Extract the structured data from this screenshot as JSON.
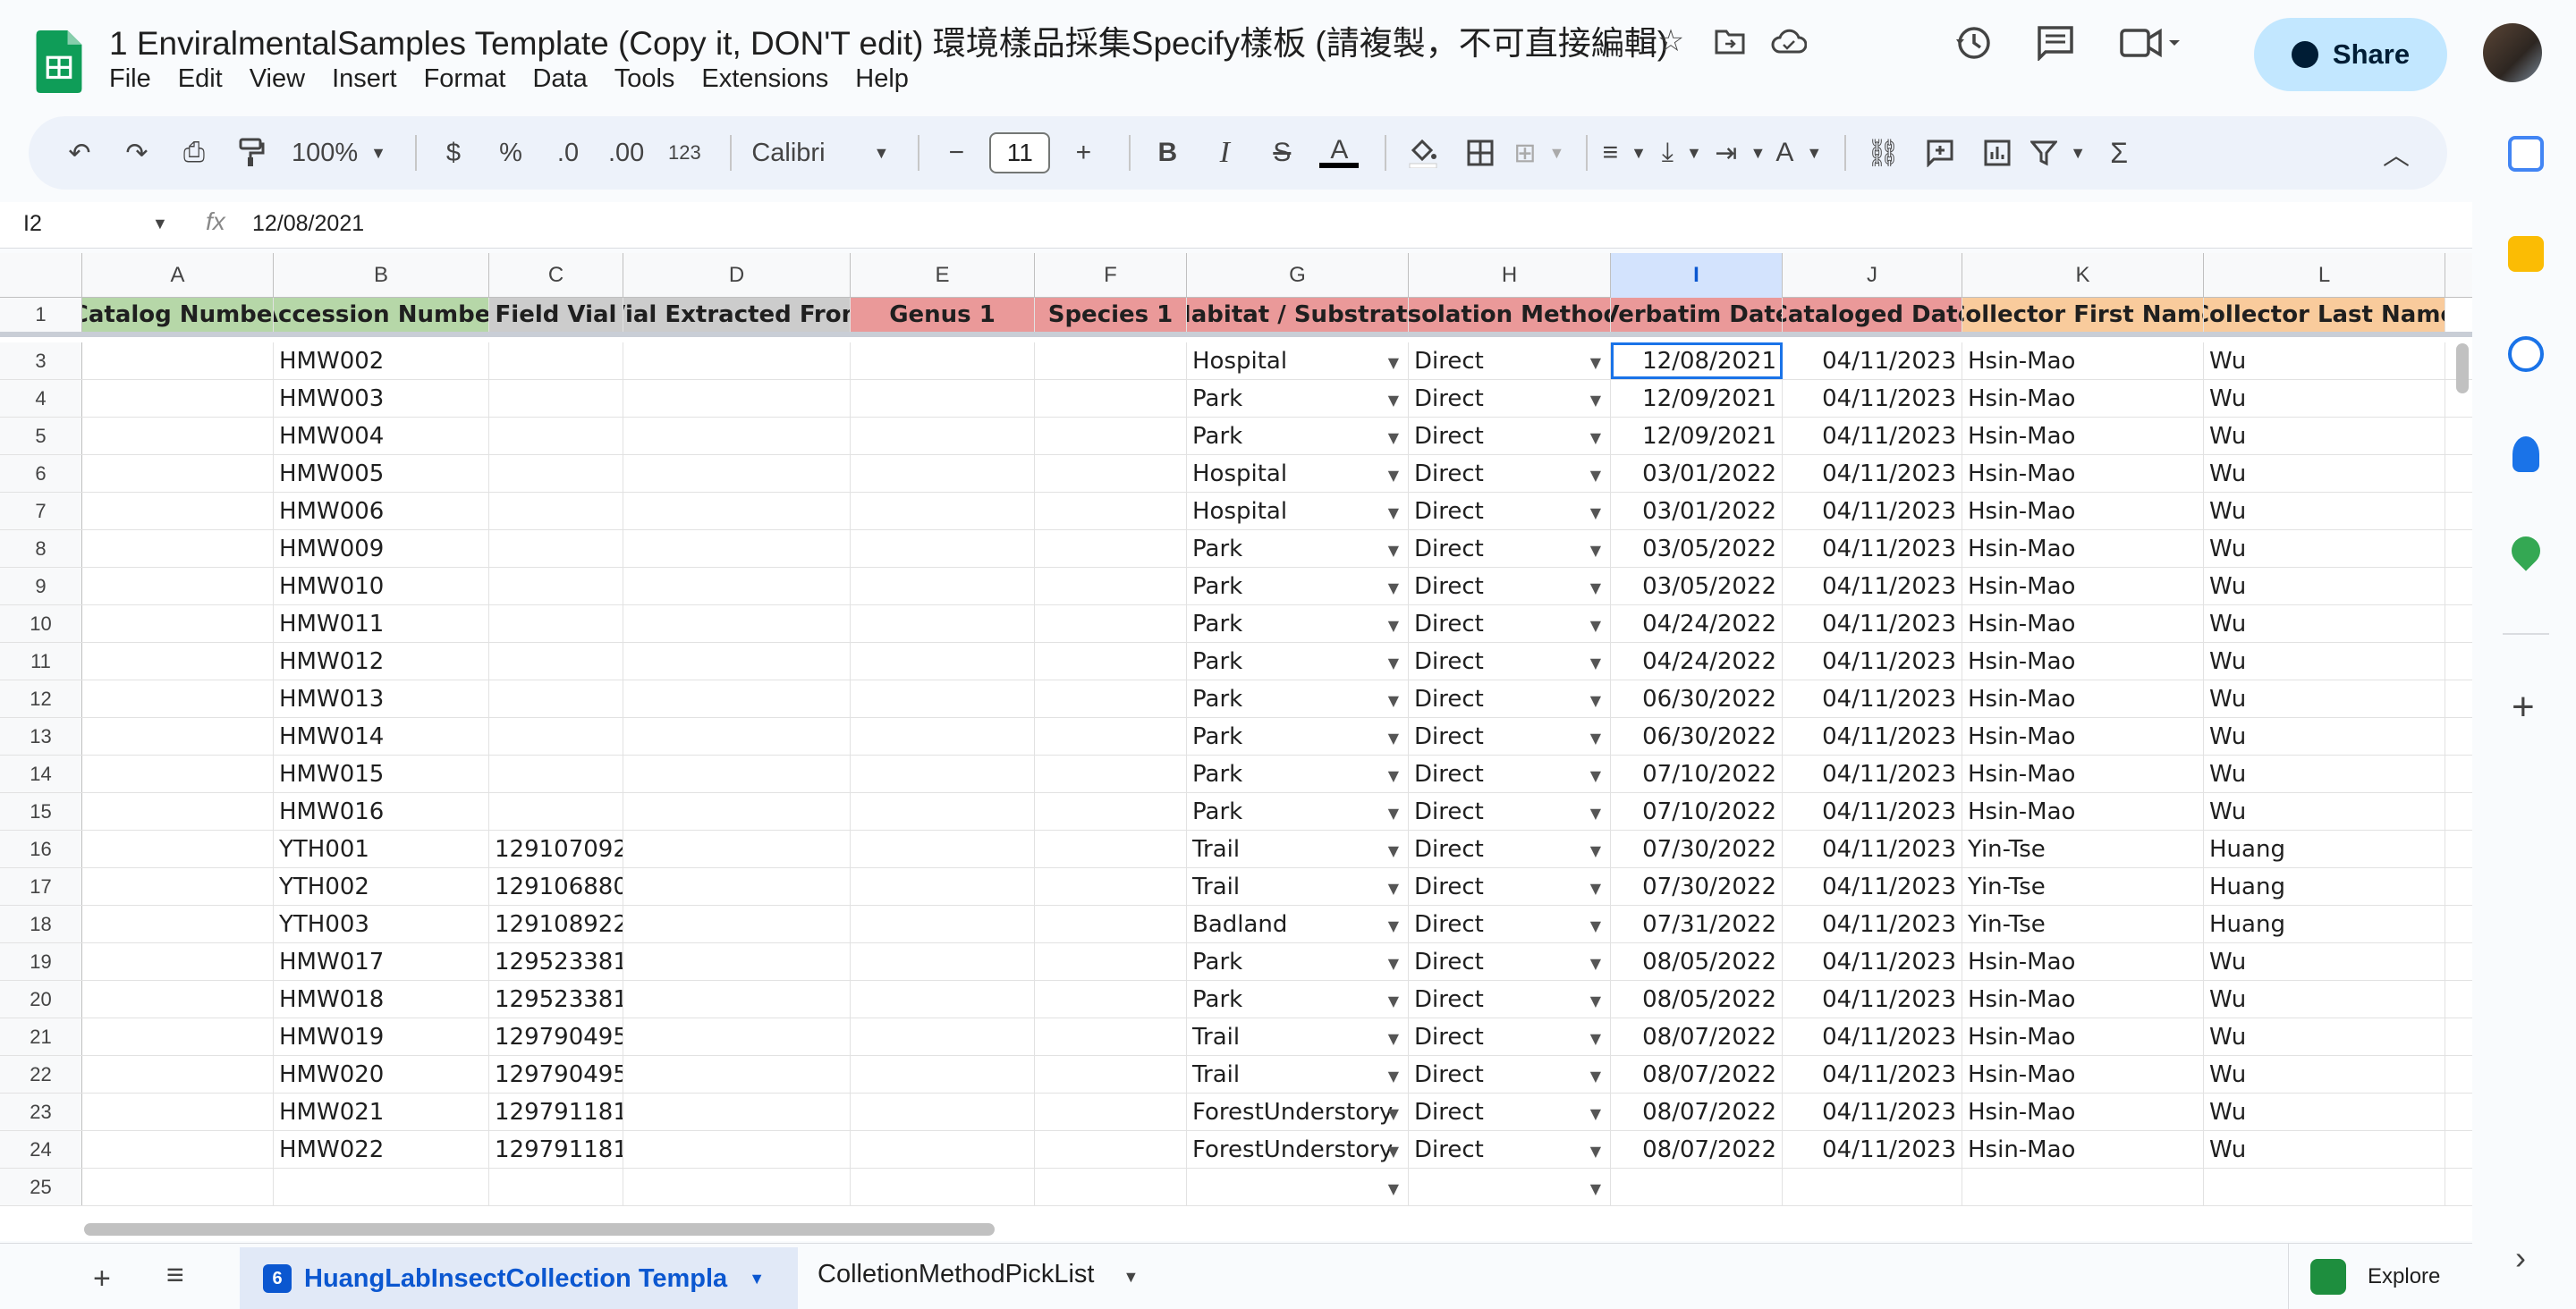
{
  "doc": {
    "title": "1 EnviralmentalSamples Template (Copy it, DON'T edit) 環境樣品採集Specify樣板 (請複製，不可直接編輯)",
    "menu": [
      "File",
      "Edit",
      "View",
      "Insert",
      "Format",
      "Data",
      "Tools",
      "Extensions",
      "Help"
    ],
    "share_label": "Share"
  },
  "toolbar": {
    "zoom": "100%",
    "currency": "$",
    "percent": "%",
    "dec_decrease": ".0",
    "dec_increase": ".00",
    "number_format": "123",
    "font": "Calibri",
    "font_size": "11",
    "bold": "B",
    "italic": "I",
    "strike": "S",
    "text_color": "A",
    "sum": "Σ"
  },
  "formula": {
    "cell_ref": "I2",
    "fx": "fx",
    "value": "12/08/2021"
  },
  "columns": [
    "A",
    "B",
    "C",
    "D",
    "E",
    "F",
    "G",
    "H",
    "I",
    "J",
    "K",
    "L"
  ],
  "headers": [
    "Catalog Number",
    "Accession Number",
    "Field Vial",
    "Vial Extracted From",
    "Genus 1",
    "Species 1",
    "Habitat / Substrate",
    "Isolation Method",
    "Verbatim Date",
    "Cataloged Date",
    "Collector First Name",
    "Collector Last Name"
  ],
  "header_colors": [
    "#b6d7a8",
    "#b6d7a8",
    "#cccccc",
    "#cccccc",
    "#ea9999",
    "#ea9999",
    "#ea9999",
    "#ea9999",
    "#ea9999",
    "#ea9999",
    "#f9cb9c",
    "#f9cb9c"
  ],
  "rows": [
    {
      "n": "3",
      "b": "HMW002",
      "c": "",
      "g": "Hospital",
      "h": "Direct",
      "i": "12/08/2021",
      "j": "04/11/2023",
      "k": "Hsin-Mao",
      "l": "Wu"
    },
    {
      "n": "4",
      "b": "HMW003",
      "c": "",
      "g": "Park",
      "h": "Direct",
      "i": "12/09/2021",
      "j": "04/11/2023",
      "k": "Hsin-Mao",
      "l": "Wu"
    },
    {
      "n": "5",
      "b": "HMW004",
      "c": "",
      "g": "Park",
      "h": "Direct",
      "i": "12/09/2021",
      "j": "04/11/2023",
      "k": "Hsin-Mao",
      "l": "Wu"
    },
    {
      "n": "6",
      "b": "HMW005",
      "c": "",
      "g": "Hospital",
      "h": "Direct",
      "i": "03/01/2022",
      "j": "04/11/2023",
      "k": "Hsin-Mao",
      "l": "Wu"
    },
    {
      "n": "7",
      "b": "HMW006",
      "c": "",
      "g": "Hospital",
      "h": "Direct",
      "i": "03/01/2022",
      "j": "04/11/2023",
      "k": "Hsin-Mao",
      "l": "Wu"
    },
    {
      "n": "8",
      "b": "HMW009",
      "c": "",
      "g": "Park",
      "h": "Direct",
      "i": "03/05/2022",
      "j": "04/11/2023",
      "k": "Hsin-Mao",
      "l": "Wu"
    },
    {
      "n": "9",
      "b": "HMW010",
      "c": "",
      "g": "Park",
      "h": "Direct",
      "i": "03/05/2022",
      "j": "04/11/2023",
      "k": "Hsin-Mao",
      "l": "Wu"
    },
    {
      "n": "10",
      "b": "HMW011",
      "c": "",
      "g": "Park",
      "h": "Direct",
      "i": "04/24/2022",
      "j": "04/11/2023",
      "k": "Hsin-Mao",
      "l": "Wu"
    },
    {
      "n": "11",
      "b": "HMW012",
      "c": "",
      "g": "Park",
      "h": "Direct",
      "i": "04/24/2022",
      "j": "04/11/2023",
      "k": "Hsin-Mao",
      "l": "Wu"
    },
    {
      "n": "12",
      "b": "HMW013",
      "c": "",
      "g": "Park",
      "h": "Direct",
      "i": "06/30/2022",
      "j": "04/11/2023",
      "k": "Hsin-Mao",
      "l": "Wu"
    },
    {
      "n": "13",
      "b": "HMW014",
      "c": "",
      "g": "Park",
      "h": "Direct",
      "i": "06/30/2022",
      "j": "04/11/2023",
      "k": "Hsin-Mao",
      "l": "Wu"
    },
    {
      "n": "14",
      "b": "HMW015",
      "c": "",
      "g": "Park",
      "h": "Direct",
      "i": "07/10/2022",
      "j": "04/11/2023",
      "k": "Hsin-Mao",
      "l": "Wu"
    },
    {
      "n": "15",
      "b": "HMW016",
      "c": "",
      "g": "Park",
      "h": "Direct",
      "i": "07/10/2022",
      "j": "04/11/2023",
      "k": "Hsin-Mao",
      "l": "Wu"
    },
    {
      "n": "16",
      "b": "YTH001",
      "c": "129107092",
      "g": "Trail",
      "h": "Direct",
      "i": "07/30/2022",
      "j": "04/11/2023",
      "k": "Yin-Tse",
      "l": "Huang"
    },
    {
      "n": "17",
      "b": "YTH002",
      "c": "129106880",
      "g": "Trail",
      "h": "Direct",
      "i": "07/30/2022",
      "j": "04/11/2023",
      "k": "Yin-Tse",
      "l": "Huang"
    },
    {
      "n": "18",
      "b": "YTH003",
      "c": "129108922",
      "g": "Badland",
      "h": "Direct",
      "i": "07/31/2022",
      "j": "04/11/2023",
      "k": "Yin-Tse",
      "l": "Huang"
    },
    {
      "n": "19",
      "b": "HMW017",
      "c": "129523381",
      "g": "Park",
      "h": "Direct",
      "i": "08/05/2022",
      "j": "04/11/2023",
      "k": "Hsin-Mao",
      "l": "Wu"
    },
    {
      "n": "20",
      "b": "HMW018",
      "c": "129523381",
      "g": "Park",
      "h": "Direct",
      "i": "08/05/2022",
      "j": "04/11/2023",
      "k": "Hsin-Mao",
      "l": "Wu"
    },
    {
      "n": "21",
      "b": "HMW019",
      "c": "129790495",
      "g": "Trail",
      "h": "Direct",
      "i": "08/07/2022",
      "j": "04/11/2023",
      "k": "Hsin-Mao",
      "l": "Wu"
    },
    {
      "n": "22",
      "b": "HMW020",
      "c": "129790495",
      "g": "Trail",
      "h": "Direct",
      "i": "08/07/2022",
      "j": "04/11/2023",
      "k": "Hsin-Mao",
      "l": "Wu"
    },
    {
      "n": "23",
      "b": "HMW021",
      "c": "129791181",
      "g": "ForestUnderstory",
      "h": "Direct",
      "i": "08/07/2022",
      "j": "04/11/2023",
      "k": "Hsin-Mao",
      "l": "Wu"
    },
    {
      "n": "24",
      "b": "HMW022",
      "c": "129791181",
      "g": "ForestUnderstory",
      "h": "Direct",
      "i": "08/07/2022",
      "j": "04/11/2023",
      "k": "Hsin-Mao",
      "l": "Wu"
    },
    {
      "n": "25",
      "b": "",
      "c": "",
      "g": "",
      "h": "",
      "i": "",
      "j": "",
      "k": "",
      "l": ""
    }
  ],
  "tabs": {
    "active_badge": "6",
    "active": "HuangLabInsectCollection Templa",
    "second": "ColletionMethodPickList",
    "explore": "Explore"
  }
}
